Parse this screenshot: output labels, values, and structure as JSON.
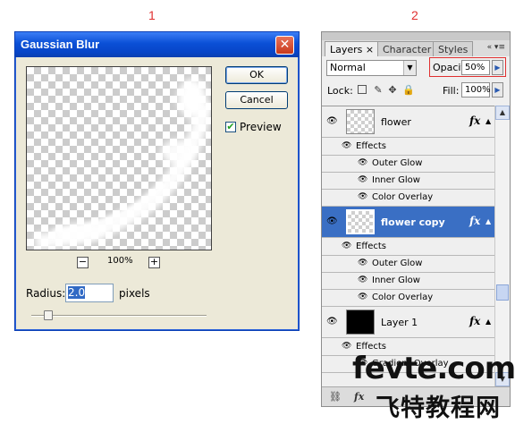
{
  "markers": {
    "left": "1",
    "right": "2"
  },
  "dialog": {
    "title": "Gaussian Blur",
    "close_glyph": "✕",
    "ok_label": "OK",
    "cancel_label": "Cancel",
    "preview_label": "Preview",
    "preview_checked": true,
    "zoom_out": "−",
    "zoom_level": "100%",
    "zoom_in": "+",
    "radius_label": "Radius:",
    "radius_value": "2.0",
    "radius_unit": "pixels",
    "radius_slider_fraction": 0.08
  },
  "panel": {
    "tabs": [
      {
        "label": "Layers ×",
        "active": true
      },
      {
        "label": "Character",
        "active": false
      },
      {
        "label": "Styles",
        "active": false
      }
    ],
    "menu_icons": "«  ▾≡",
    "blend_mode": "Normal",
    "opacity_label": "Opacity:",
    "opacity_value": "50%",
    "lock_label": "Lock:",
    "fill_label": "Fill:",
    "fill_value": "100%",
    "layers": [
      {
        "type": "layer",
        "name": "flower",
        "thumb": "transparent",
        "fx": "fx",
        "selected": false
      },
      {
        "type": "sub",
        "level": 1,
        "name": "Effects"
      },
      {
        "type": "sub",
        "level": 2,
        "name": "Outer Glow"
      },
      {
        "type": "sub",
        "level": 2,
        "name": "Inner Glow"
      },
      {
        "type": "sub",
        "level": 2,
        "name": "Color Overlay"
      },
      {
        "type": "layer",
        "name": "flower copy",
        "thumb": "transparent",
        "fx": "fx",
        "selected": true
      },
      {
        "type": "sub",
        "level": 1,
        "name": "Effects"
      },
      {
        "type": "sub",
        "level": 2,
        "name": "Outer Glow"
      },
      {
        "type": "sub",
        "level": 2,
        "name": "Inner Glow"
      },
      {
        "type": "sub",
        "level": 2,
        "name": "Color Overlay"
      },
      {
        "type": "layer",
        "name": "Layer 1",
        "thumb": "black",
        "fx": "fx",
        "selected": false
      },
      {
        "type": "sub",
        "level": 1,
        "name": "Effects"
      },
      {
        "type": "sub",
        "level": 2,
        "name": "Gradient Overlay"
      }
    ]
  },
  "watermark": {
    "line1": "fevte.com",
    "line2": "飞特教程网"
  },
  "colors": {
    "selection": "#3a6fc4",
    "titlebar": "#0a4fd6",
    "highlight_box": "#e03030"
  }
}
